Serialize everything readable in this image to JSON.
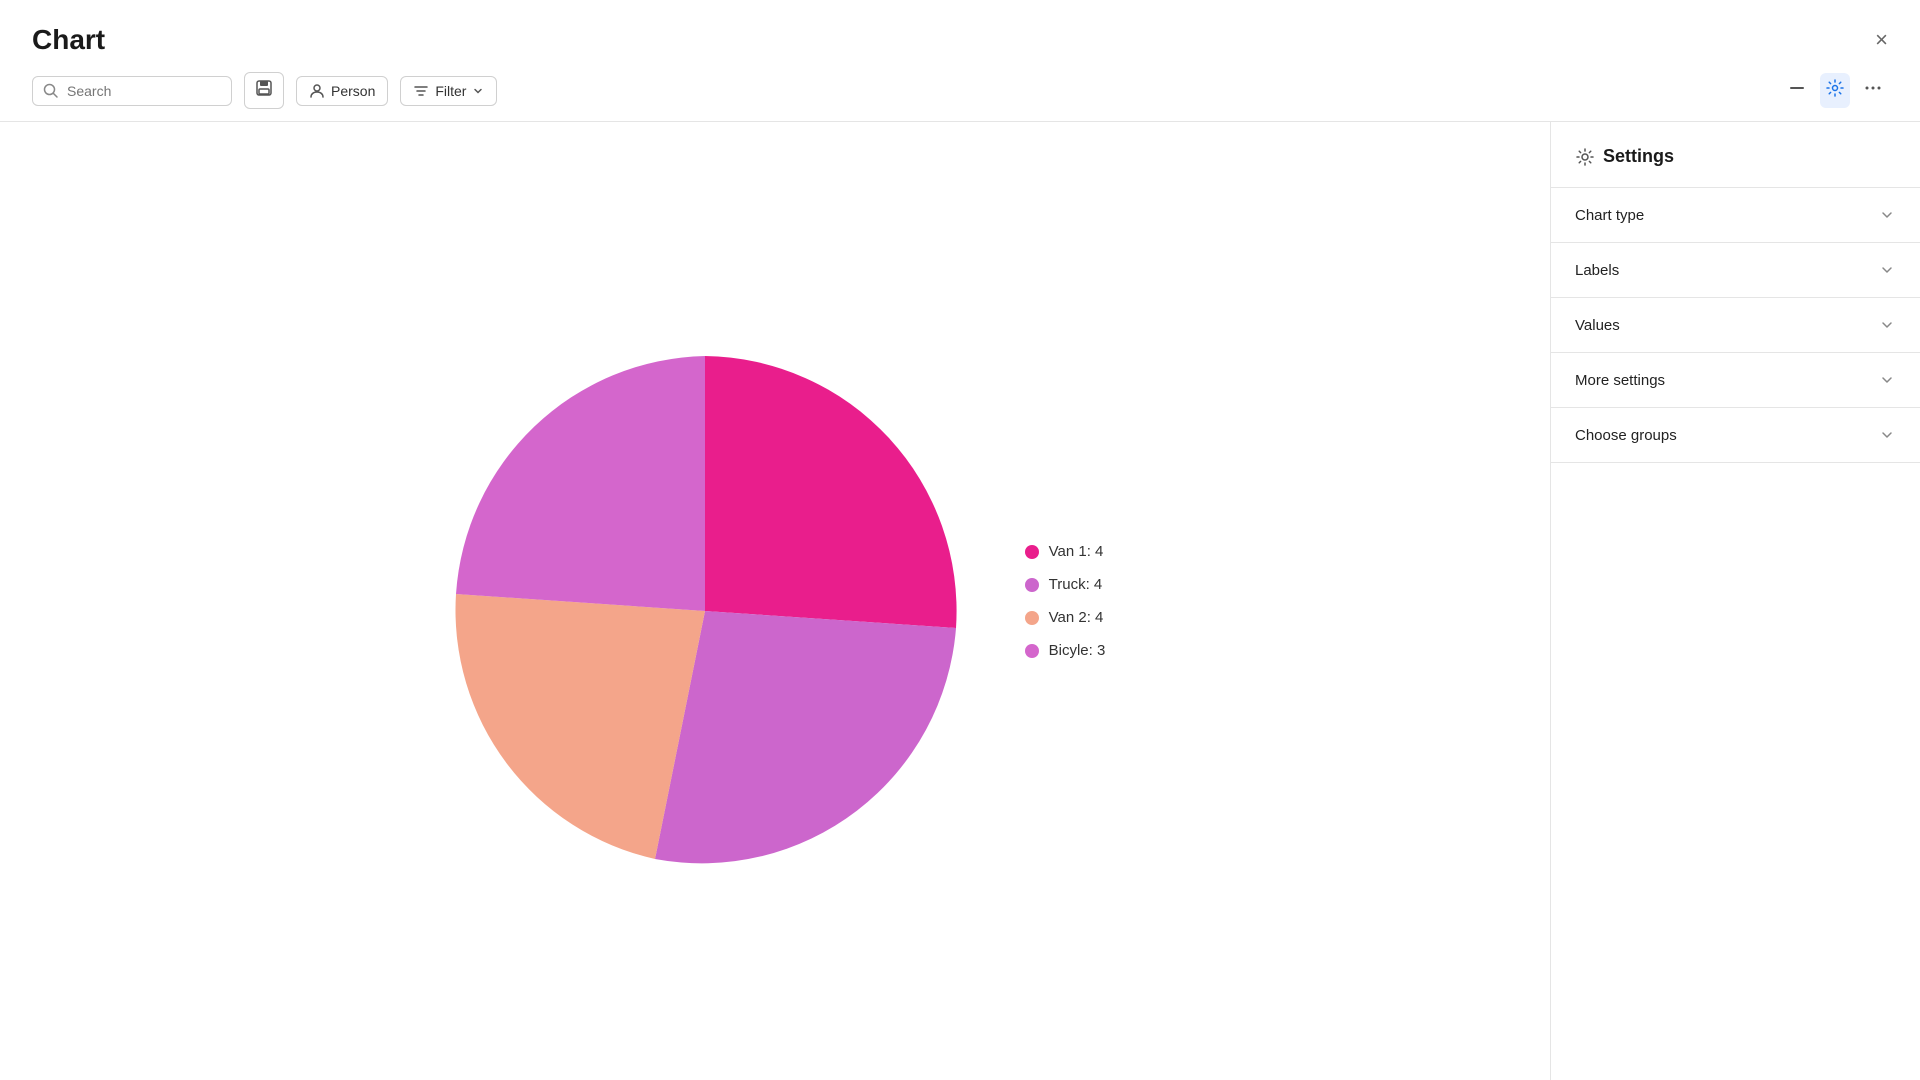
{
  "header": {
    "title": "Chart",
    "close_label": "×"
  },
  "toolbar": {
    "search_placeholder": "Search",
    "person_label": "Person",
    "filter_label": "Filter",
    "save_icon": "💾",
    "minimize_icon": "—",
    "settings_icon": "⚙",
    "more_icon": "···"
  },
  "chart": {
    "segments": [
      {
        "label": "Van 1",
        "value": 4,
        "color": "#e91e8c",
        "startAngle": 0,
        "endAngle": 90
      },
      {
        "label": "Truck",
        "value": 4,
        "color": "#cc66cc",
        "startAngle": 90,
        "endAngle": 180
      },
      {
        "label": "Van 2",
        "value": 4,
        "color": "#f4a58a",
        "startAngle": 180,
        "endAngle": 270
      },
      {
        "label": "Bicyle",
        "value": 3,
        "color": "#d466cc",
        "startAngle": 270,
        "endAngle": 360
      }
    ]
  },
  "legend": [
    {
      "label": "Van 1: 4",
      "color": "#e91e8c"
    },
    {
      "label": "Truck: 4",
      "color": "#cc66cc"
    },
    {
      "label": "Van 2: 4",
      "color": "#f4a58a"
    },
    {
      "label": "Bicyle: 3",
      "color": "#d466cc"
    }
  ],
  "settings": {
    "title": "Settings",
    "accordion_items": [
      {
        "label": "Chart type"
      },
      {
        "label": "Labels"
      },
      {
        "label": "Values"
      },
      {
        "label": "More settings"
      },
      {
        "label": "Choose groups"
      }
    ]
  }
}
